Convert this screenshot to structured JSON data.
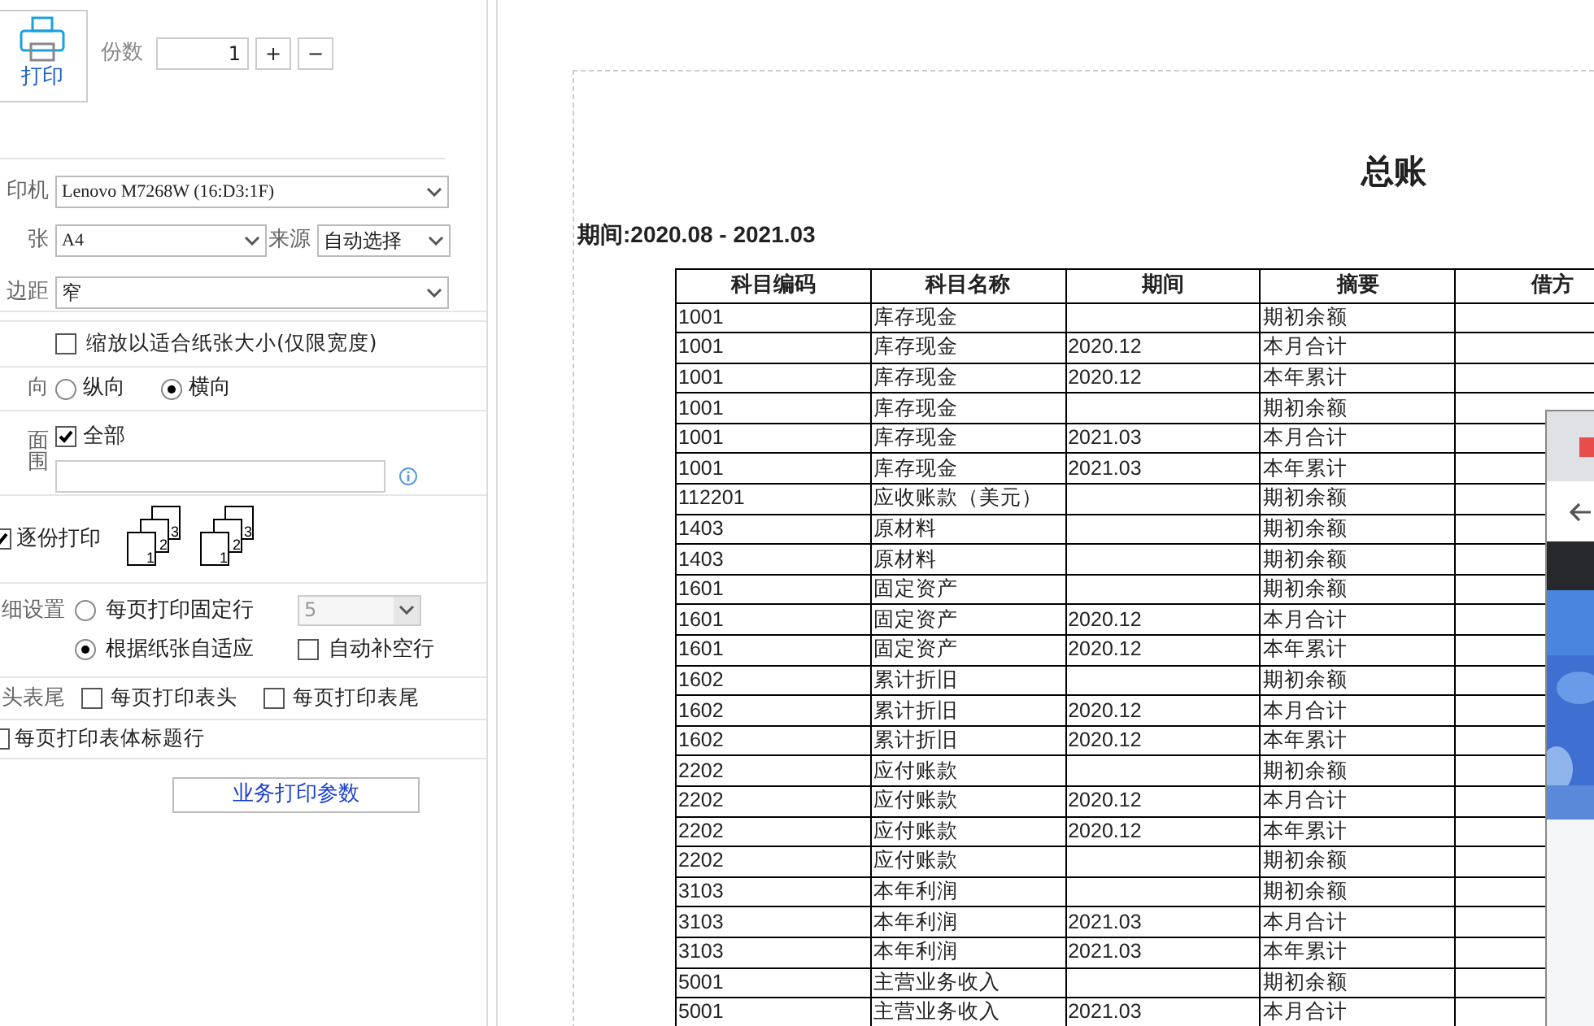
{
  "print_button": {
    "label": "打印"
  },
  "copies": {
    "label": "份数",
    "value": "1",
    "plus": "+",
    "minus": "−"
  },
  "printer": {
    "label": "印机",
    "value": "Lenovo M7268W (16:D3:1F)"
  },
  "paper": {
    "label": "张",
    "value": "A4",
    "source_label": "来源",
    "source_value": "自动选择"
  },
  "margin": {
    "label": "边距",
    "value": "窄"
  },
  "fit_to_width": {
    "label": "缩放以适合纸张大小(仅限宽度)",
    "checked": false
  },
  "orientation": {
    "label": "向",
    "options": [
      {
        "label": "纵向",
        "selected": false
      },
      {
        "label": "横向",
        "selected": true
      }
    ]
  },
  "page_range": {
    "label_lines": [
      "面",
      "围"
    ],
    "all": {
      "label": "全部",
      "checked": true
    }
  },
  "collate": {
    "label": "逐份打印",
    "checked": true,
    "icons": [
      [
        "3",
        "2",
        "1"
      ],
      [
        "3",
        "2",
        "1"
      ]
    ]
  },
  "detail": {
    "label": "细设置",
    "options": [
      {
        "label": "每页打印固定行",
        "selected": false
      },
      {
        "label": "根据纸张自适应",
        "selected": true
      }
    ],
    "rows_value": "5",
    "rows_disabled": true,
    "auto_fill": {
      "label": "自动补空行",
      "checked": false
    }
  },
  "header_footer": {
    "label": "头表尾",
    "items": [
      {
        "label": "每页打印表头",
        "checked": false
      },
      {
        "label": "每页打印表尾",
        "checked": false
      }
    ]
  },
  "title_rows": {
    "label": "每页打印表体标题行",
    "checked": false
  },
  "business_button": {
    "label": "业务打印参数"
  },
  "preview": {
    "title": "总账",
    "period": "期间:2020.08 - 2021.03",
    "columns": [
      "科目编码",
      "科目名称",
      "期间",
      "摘要",
      "借方"
    ],
    "rows": [
      [
        "1001",
        "库存现金",
        "",
        "期初余额"
      ],
      [
        "1001",
        "库存现金",
        "2020.12",
        "本月合计"
      ],
      [
        "1001",
        "库存现金",
        "2020.12",
        "本年累计"
      ],
      [
        "1001",
        "库存现金",
        "",
        "期初余额"
      ],
      [
        "1001",
        "库存现金",
        "2021.03",
        "本月合计"
      ],
      [
        "1001",
        "库存现金",
        "2021.03",
        "本年累计"
      ],
      [
        "112201",
        "应收账款（美元）",
        "",
        "期初余额"
      ],
      [
        "1403",
        "原材料",
        "",
        "期初余额"
      ],
      [
        "1403",
        "原材料",
        "",
        "期初余额"
      ],
      [
        "1601",
        "固定资产",
        "",
        "期初余额"
      ],
      [
        "1601",
        "固定资产",
        "2020.12",
        "本月合计"
      ],
      [
        "1601",
        "固定资产",
        "2020.12",
        "本年累计"
      ],
      [
        "1602",
        "累计折旧",
        "",
        "期初余额"
      ],
      [
        "1602",
        "累计折旧",
        "2020.12",
        "本月合计"
      ],
      [
        "1602",
        "累计折旧",
        "2020.12",
        "本年累计"
      ],
      [
        "2202",
        "应付账款",
        "",
        "期初余额"
      ],
      [
        "2202",
        "应付账款",
        "2020.12",
        "本月合计"
      ],
      [
        "2202",
        "应付账款",
        "2020.12",
        "本年累计"
      ],
      [
        "2202",
        "应付账款",
        "",
        "期初余额"
      ],
      [
        "3103",
        "本年利润",
        "",
        "期初余额"
      ],
      [
        "3103",
        "本年利润",
        "2021.03",
        "本月合计"
      ],
      [
        "3103",
        "本年利润",
        "2021.03",
        "本年累计"
      ],
      [
        "5001",
        "主营业务收入",
        "",
        "期初余额"
      ],
      [
        "5001",
        "主营业务收入",
        "2021.03",
        "本月合计"
      ]
    ]
  }
}
